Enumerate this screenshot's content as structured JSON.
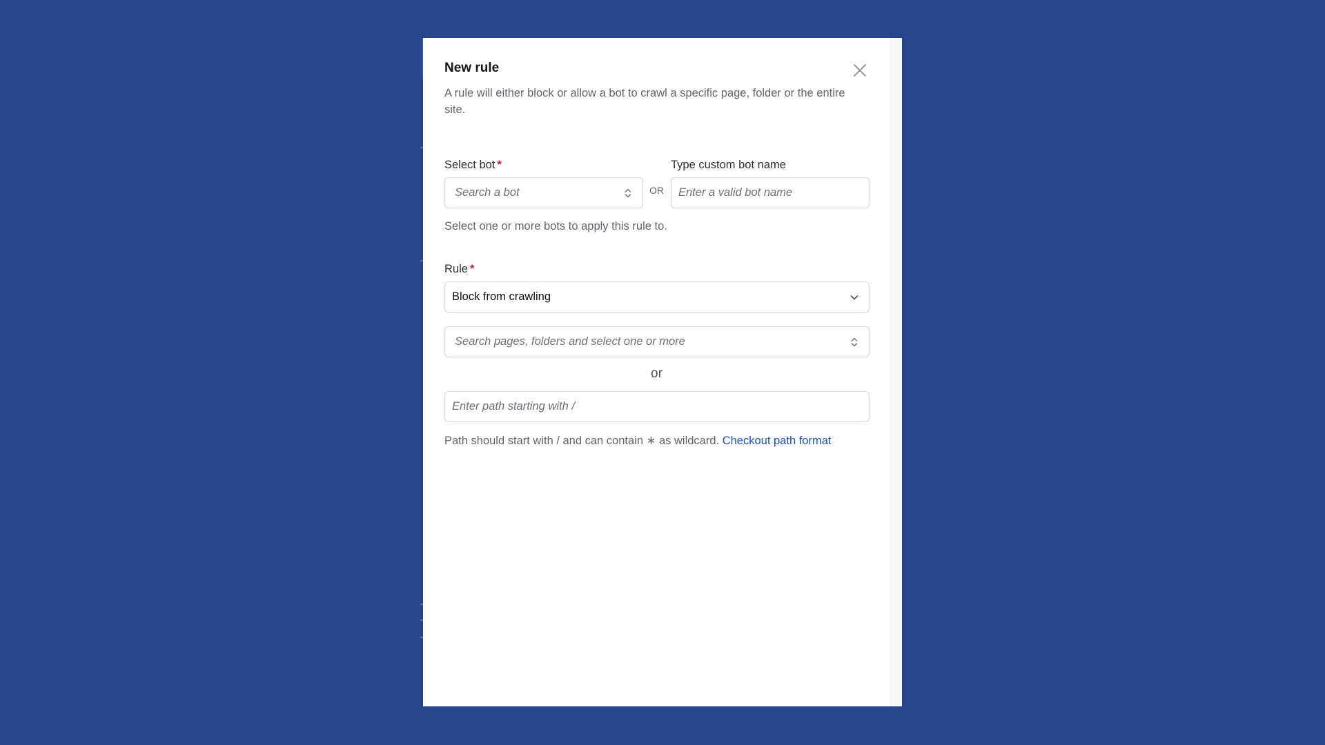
{
  "modal": {
    "title": "New rule",
    "description": "A rule will either block or allow a bot to crawl a specific page, folder or the entire site.",
    "close_icon": "close-icon"
  },
  "bot_section": {
    "select_label": "Select bot",
    "required_mark": "*",
    "select_placeholder": "Search a bot",
    "select_icon": "up-down-chevron-icon",
    "or_label": "OR",
    "custom_label": "Type custom bot name",
    "custom_placeholder": "Enter a valid bot name",
    "helper": "Select one or more bots to apply this rule to."
  },
  "rule_section": {
    "label": "Rule",
    "required_mark": "*",
    "selected_value": "Block from crawling",
    "select_icon": "chevron-down-icon",
    "pages_placeholder": "Search pages, folders and select one or more",
    "pages_icon": "up-down-chevron-icon",
    "or_label": "or",
    "path_placeholder": "Enter path starting with /",
    "helper": "Path should start with / and can contain ∗ as wildcard.",
    "helper_link": "Checkout path format"
  },
  "colors": {
    "background": "#24468c",
    "link": "#1f4fbf",
    "required": "#d1242f"
  }
}
